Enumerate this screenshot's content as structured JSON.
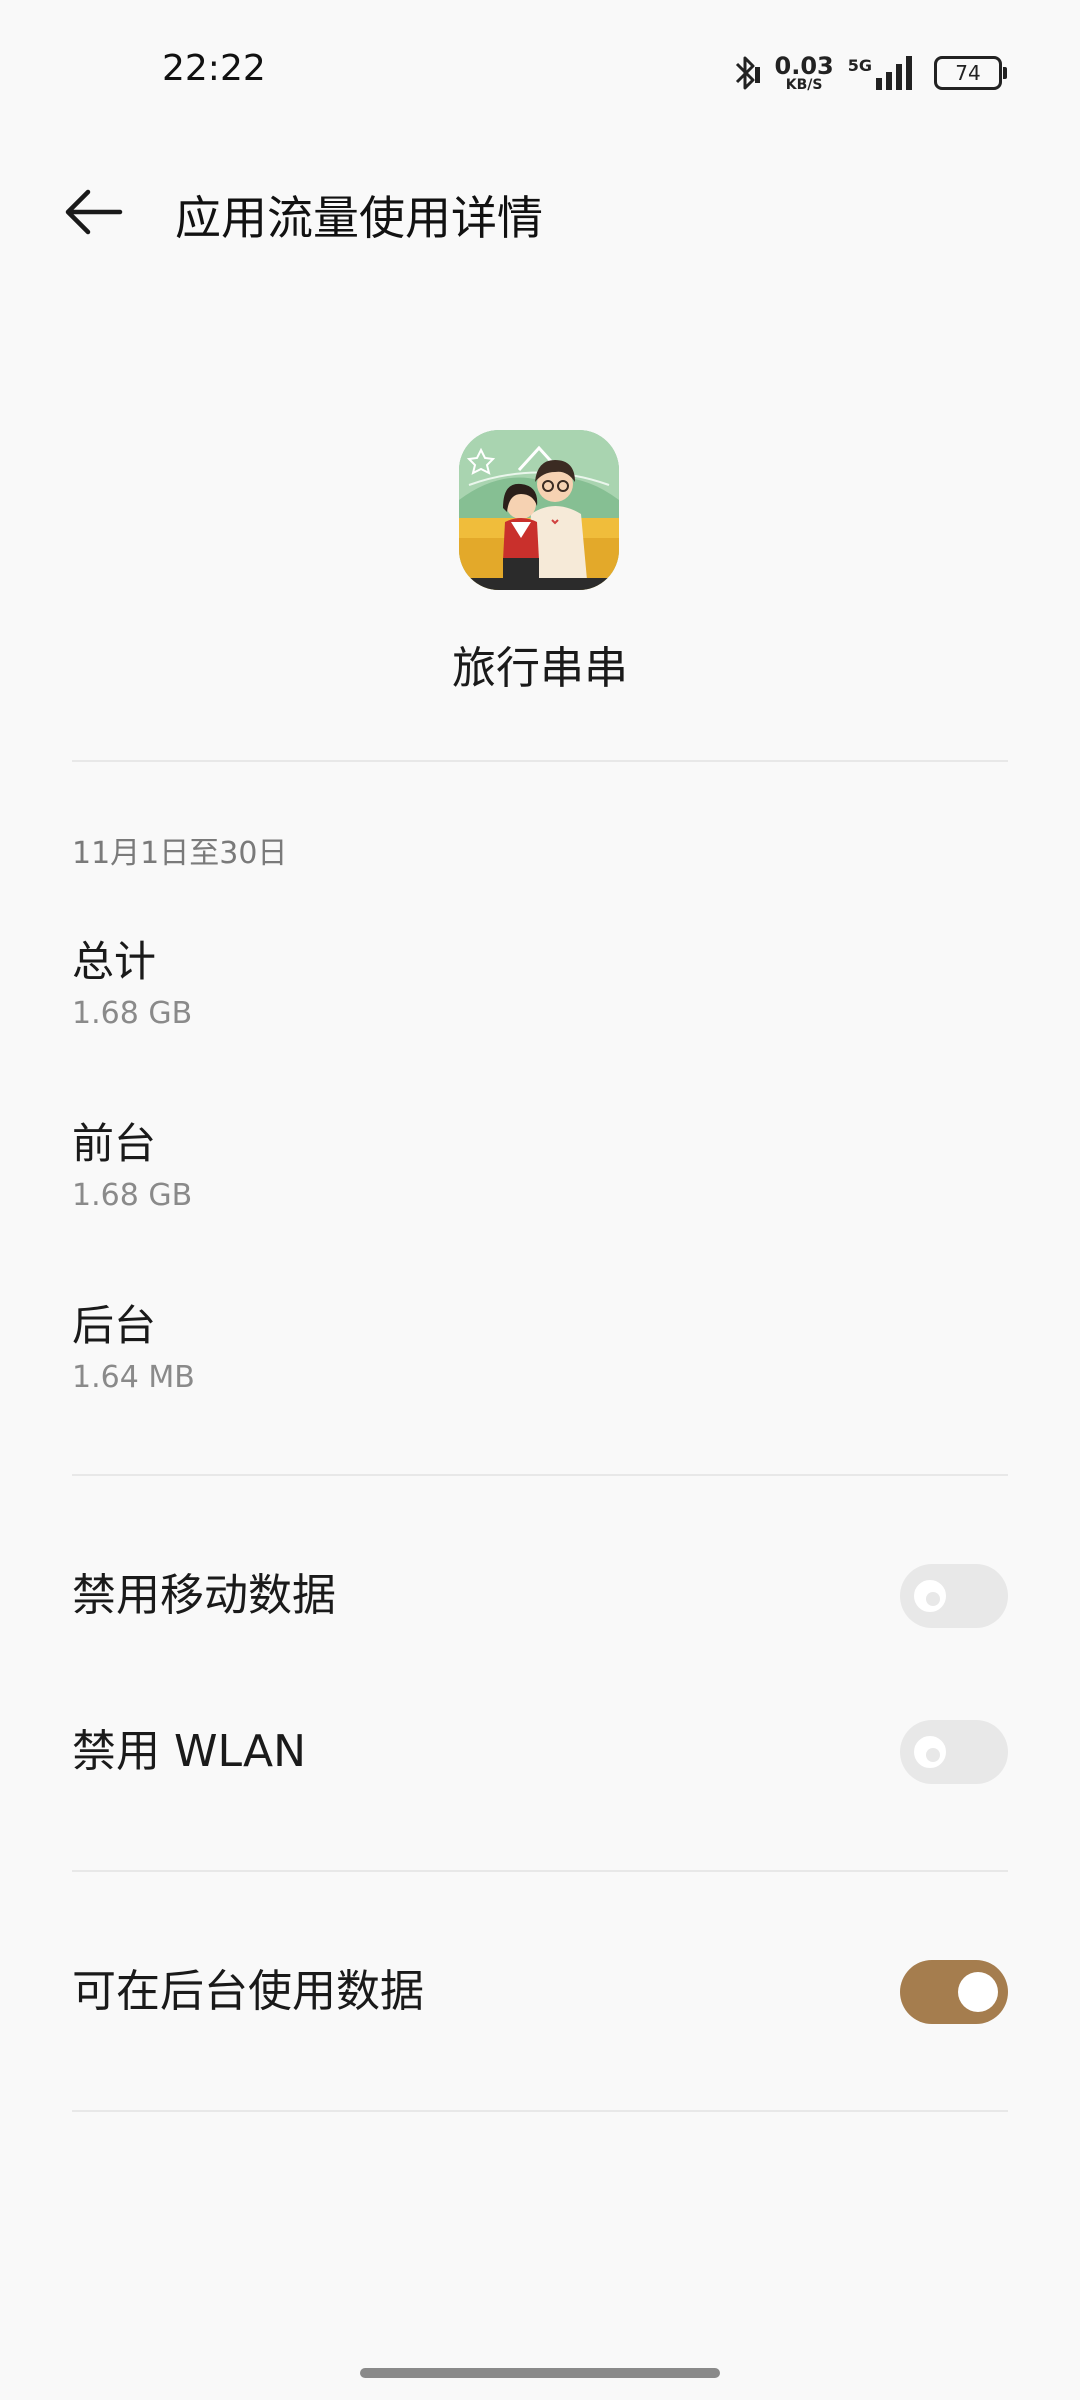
{
  "status_bar": {
    "time": "22:22",
    "speed_value": "0.03",
    "speed_unit": "KB/S",
    "network_type": "5G",
    "battery": "74"
  },
  "header": {
    "title": "应用流量使用详情"
  },
  "app": {
    "name": "旅行串串"
  },
  "usage": {
    "date_range": "11月1日至30日",
    "stats": [
      {
        "label": "总计",
        "value": "1.68 GB"
      },
      {
        "label": "前台",
        "value": "1.68 GB"
      },
      {
        "label": "后台",
        "value": "1.64 MB"
      }
    ]
  },
  "settings": [
    {
      "label": "禁用移动数据",
      "enabled": false
    },
    {
      "label": "禁用 WLAN",
      "enabled": false
    },
    {
      "label": "可在后台使用数据",
      "enabled": true
    }
  ],
  "colors": {
    "accent": "#a57d4e",
    "background": "#f9f9f9",
    "toggle_off": "#e8e8e8"
  }
}
